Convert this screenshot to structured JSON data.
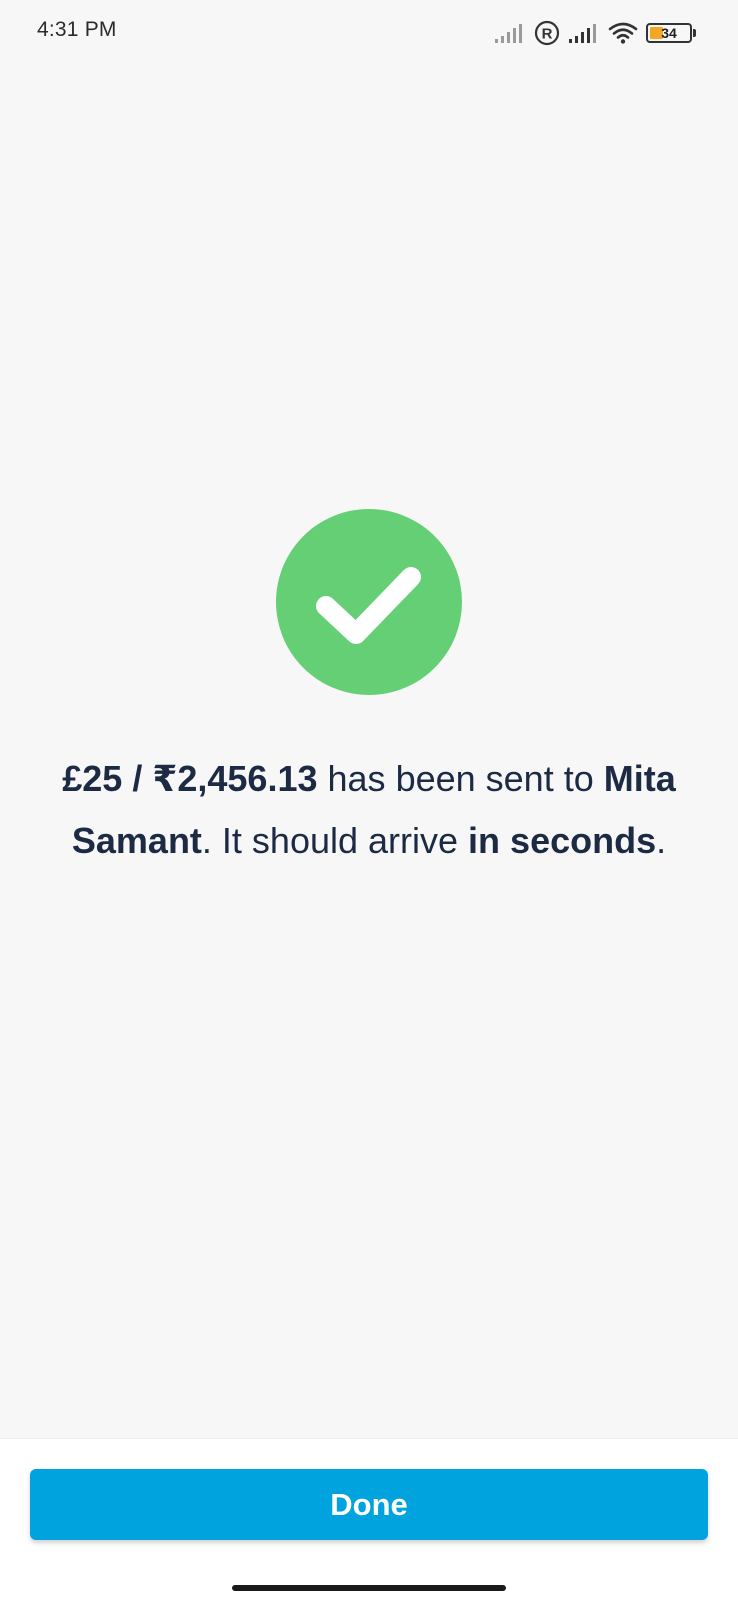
{
  "status_bar": {
    "time": "4:31 PM",
    "battery_level": "34",
    "battery_fraction": 0.34,
    "icons": [
      "signal-icon",
      "roaming-icon",
      "signal-icon",
      "wifi-icon",
      "battery-icon"
    ]
  },
  "success": {
    "icon": "check-icon",
    "icon_color": "#64cf74",
    "amount": "£25 / ₹2,456.13",
    "text_sent": " has been sent to ",
    "recipient": "Mita Samant",
    "text_arrive": ". It should arrive ",
    "eta": "in seconds",
    "text_end": "."
  },
  "actions": {
    "done_label": "Done",
    "done_color": "#00a3dd"
  }
}
